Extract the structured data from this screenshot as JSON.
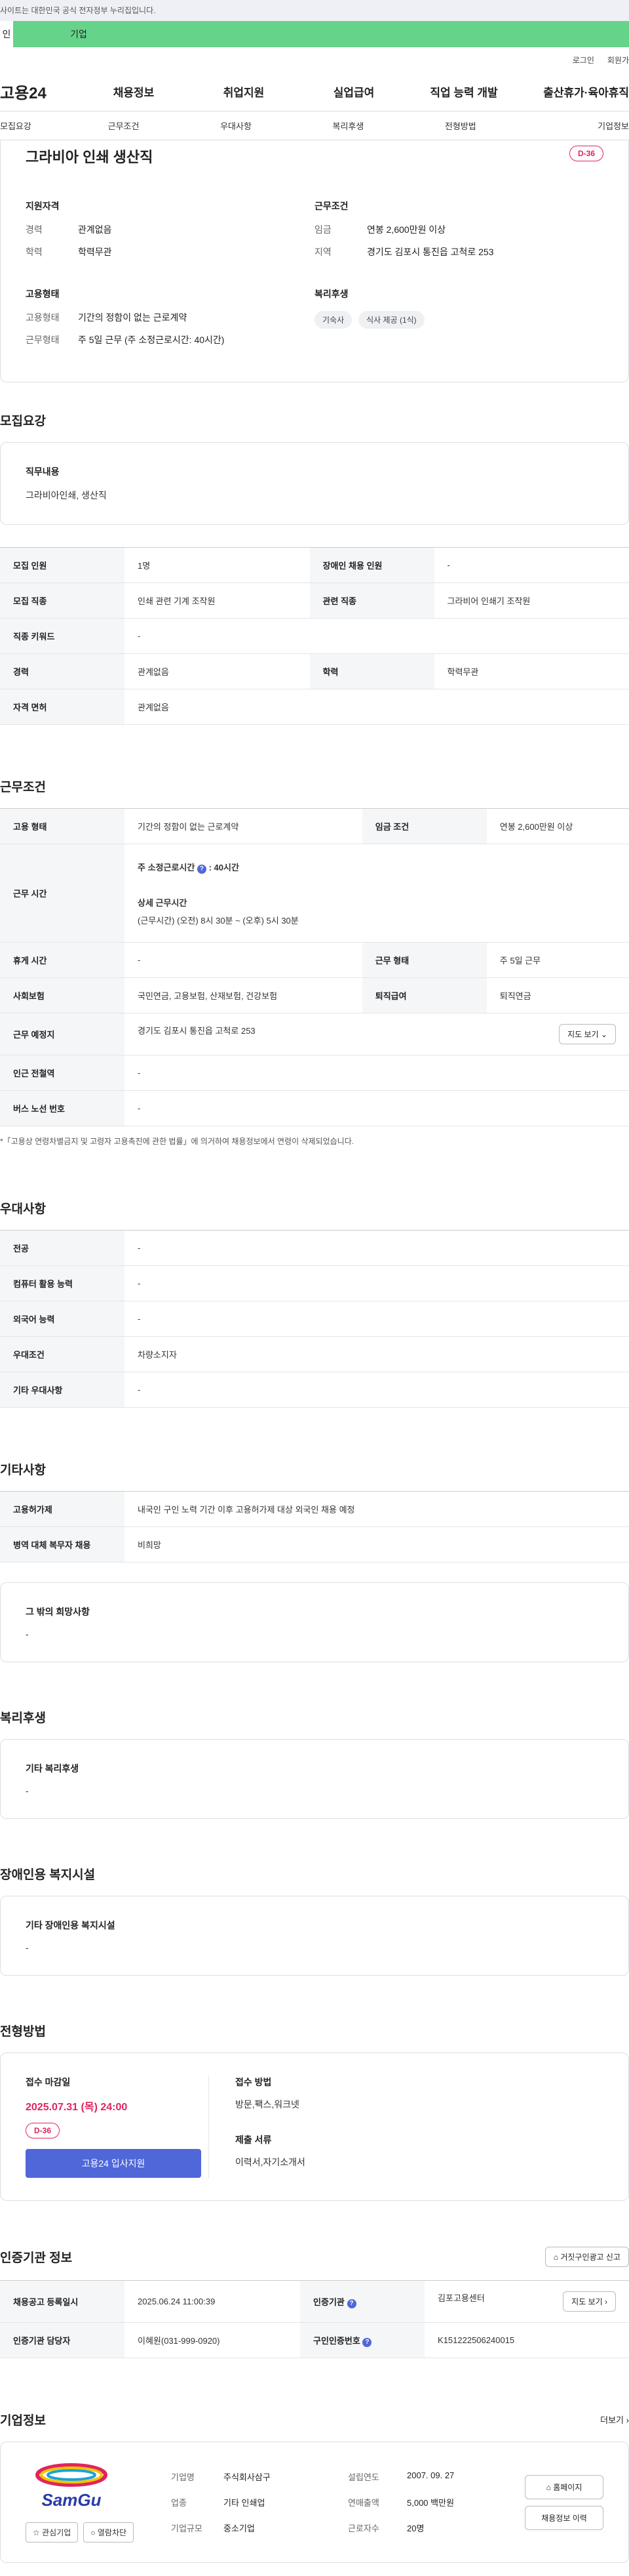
{
  "banner": "사이트는 대한민국 공식 전자정부 누리집입니다.",
  "tabs": [
    "인",
    "기업"
  ],
  "util": [
    "로그인",
    "회원가"
  ],
  "gnb": {
    "logo": "고용24",
    "items": [
      "채용정보",
      "취업지원",
      "실업급여",
      "직업 능력 개발",
      "출산휴가·육아휴직"
    ]
  },
  "subnav": [
    "모집요강",
    "근무조건",
    "우대사항",
    "복리후생",
    "전형방법",
    "기업정보"
  ],
  "summary": {
    "title": "그라비아 인쇄 생산직",
    "dday": "D-36",
    "qual": {
      "h": "지원자격",
      "rows": [
        [
          "경력",
          "관계없음"
        ],
        [
          "학력",
          "학력무관"
        ]
      ]
    },
    "cond": {
      "h": "근무조건",
      "rows": [
        [
          "임금",
          "연봉 2,600만원 이상"
        ],
        [
          "지역",
          "경기도 김포시 통진읍 고척로 253"
        ]
      ]
    },
    "emp": {
      "h": "고용형태",
      "rows": [
        [
          "고용형태",
          "기간의 정함이 없는 근로계약"
        ],
        [
          "근무형태",
          "주 5일 근무 (주 소정근로시간: 40시간)"
        ]
      ]
    },
    "welfare": {
      "h": "복리후생",
      "chips": [
        "기숙사",
        "식사 제공 (1식)"
      ]
    }
  },
  "recruit": {
    "h": "모집요강",
    "duty_h": "직무내용",
    "duty": "그라비아인쇄, 생산직",
    "rows": [
      [
        "모집 인원",
        "1명",
        "장애인 채용 인원",
        "-"
      ],
      [
        "모집 직종",
        "인쇄 관련 기계 조작원",
        "관련 직종",
        "그라비어 인쇄기 조작원"
      ],
      [
        "직종 키워드",
        "-"
      ],
      [
        "경력",
        "관계없음",
        "학력",
        "학력무관"
      ],
      [
        "자격 면허",
        "관계없음"
      ]
    ]
  },
  "work": {
    "h": "근무조건",
    "type_k": "고용 형태",
    "type_v": "기간의 정함이 없는 근로계약",
    "wage_k": "임금 조건",
    "wage_v": "연봉 2,600만원 이상",
    "time_k": "근무 시간",
    "weekly": "주 소정근로시간",
    "weekly_v": ": 40시간",
    "detail_h": "상세 근무시간",
    "detail_v": "(근무시간) (오전) 8시 30분 ~ (오후) 5시 30분",
    "rest_k": "휴게 시간",
    "rest_v": "-",
    "form_k": "근무 형태",
    "form_v": "주 5일 근무",
    "ins_k": "사회보험",
    "ins_v": "국민연금, 고용보험, 산재보험, 건강보험",
    "ret_k": "퇴직급여",
    "ret_v": "퇴직연금",
    "place_k": "근무 예정지",
    "place_v": "경기도 김포시 통진읍 고척로 253",
    "map_btn": "지도 보기",
    "sub_k": "인근 전철역",
    "sub_v": "-",
    "bus_k": "버스 노선 번호",
    "bus_v": "-",
    "note": "*「고용상 연령차별금지 및 고령자 고용촉진에 관한 법률」에 의거하여 채용정보에서 연령이 삭제되었습니다."
  },
  "pref": {
    "h": "우대사항",
    "rows": [
      [
        "전공",
        "-"
      ],
      [
        "컴퓨터 활용 능력",
        "-"
      ],
      [
        "외국어 능력",
        "-"
      ],
      [
        "우대조건",
        "차량소지자"
      ],
      [
        "기타 우대사항",
        "-"
      ]
    ]
  },
  "etc": {
    "h": "기타사항",
    "rows": [
      [
        "고용허가제",
        "내국인 구인 노력 기간 이후 고용허가제 대상 외국인 채용 예정"
      ],
      [
        "병역 대체 복무자 채용",
        "비희망"
      ]
    ],
    "hope_h": "그 밖의 희망사항",
    "hope_v": "-"
  },
  "benefit": {
    "h": "복리후생",
    "box_h": "기타 복리후생",
    "box_v": "-"
  },
  "disabled": {
    "h": "장애인용 복지시설",
    "box_h": "기타 장애인용 복지시설",
    "box_v": "-"
  },
  "apply": {
    "h": "전형방법",
    "dl_h": "접수 마감일",
    "dl": "2025.07.31 (목) 24:00",
    "dday": "D-36",
    "btn": "고용24 입사지원",
    "method_h": "접수 방법",
    "method_v": "방문,팩스,워크넷",
    "docs_h": "제출 서류",
    "docs_v": "이력서,자기소개서"
  },
  "cert": {
    "h": "인증기관 정보",
    "report_btn": "거짓구인광고 신고",
    "rows": [
      [
        "채용공고 등록일시",
        "2025.06.24 11:00:39",
        "인증기관",
        "김포고용센터"
      ],
      [
        "인증기관 담당자",
        "이혜원(031-999-0920)",
        "구인인증번호",
        "K151222506240015"
      ]
    ],
    "map_btn": "지도 보기"
  },
  "company": {
    "h": "기업정보",
    "more": "더보기",
    "logo_text": "SamGu",
    "fav": "관심기업",
    "block": "열람차단",
    "info": [
      [
        "기업명",
        "주식회사삼구",
        "설립연도",
        "2007. 09. 27"
      ],
      [
        "업종",
        "기타 인쇄업",
        "연매출액",
        "5,000 백만원"
      ],
      [
        "기업규모",
        "중소기업",
        "근로자수",
        "20명"
      ]
    ],
    "home_btn": "홈페이지",
    "hist_btn": "채용정보 이력"
  }
}
